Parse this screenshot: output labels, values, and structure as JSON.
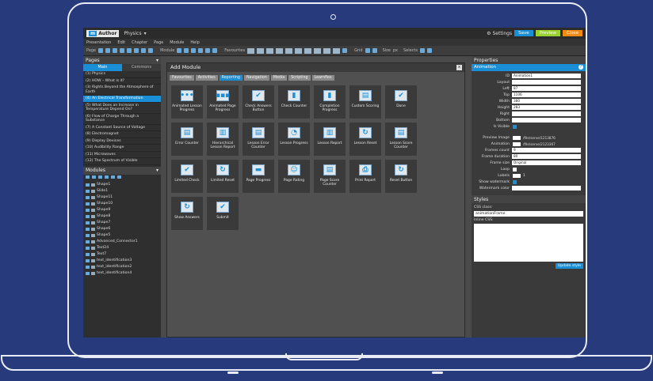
{
  "app": {
    "logo": "Author",
    "project": "Physics",
    "settings": "Settings",
    "save": "Save",
    "preview": "Preview",
    "close": "Close"
  },
  "menu": [
    "Presentation",
    "Edit",
    "Chapter",
    "Page",
    "Module",
    "Help"
  ],
  "toolbar": {
    "page": "Page",
    "module": "Module",
    "favourites": "Favourites",
    "grid": "Grid",
    "size": "Size",
    "px": "px",
    "selects": "Selects"
  },
  "pages_panel": {
    "title": "Pages",
    "tabs": [
      "Main",
      "Commons"
    ],
    "items": [
      "(1) Physics",
      "(2) HOW – What is it?",
      "(3) Rights Beyond the Atmosphere of Earth",
      "(4) An Electrical Transformation",
      "(5) What Does an Increase in Temperature Depend On?",
      "(6) Flow of Charge Through a Substance",
      "(7) A Constant Source of Voltage",
      "(8) Electromagnet",
      "(9) Display Devices",
      "(10) Audibility Range",
      "(11) Microwaves",
      "(12) The Spectrum of Visible"
    ],
    "selected_index": 3
  },
  "modules_panel": {
    "title": "Modules",
    "items": [
      "Shape1",
      "Slide1",
      "Shape11",
      "Shape10",
      "Shape9",
      "Shape8",
      "Shape7",
      "Shape6",
      "Shape5",
      "Advanced_Connector1",
      "Text24",
      "Text7",
      "text_identification3",
      "text_identification2",
      "text_identification4"
    ]
  },
  "dialog": {
    "title": "Add Module",
    "close": "x",
    "categories": [
      "Favourites",
      "Activities",
      "Reporting",
      "Navigation",
      "Media",
      "Scripting",
      "Learnflex"
    ],
    "active_category": "Reporting",
    "modules": [
      {
        "label": "Animated Lesson Progress",
        "icon": "progress-icon",
        "glyph": "•••"
      },
      {
        "label": "Animated Page Progress",
        "icon": "progress-icon",
        "glyph": "▪▪▪"
      },
      {
        "label": "Check Answers Button",
        "icon": "check-icon",
        "glyph": "✔"
      },
      {
        "label": "Check Counter",
        "icon": "counter-icon",
        "glyph": "▮"
      },
      {
        "label": "Completion Progress",
        "icon": "completion-icon",
        "glyph": "▮"
      },
      {
        "label": "Custom Scoring",
        "icon": "scoring-icon",
        "glyph": "▤"
      },
      {
        "label": "Done",
        "icon": "done-icon",
        "glyph": "✔"
      },
      {
        "label": "Error Counter",
        "icon": "error-counter-icon",
        "glyph": "▤"
      },
      {
        "label": "Hierarchical Lesson Report",
        "icon": "bar-chart-icon",
        "glyph": "▥"
      },
      {
        "label": "Lesson Error Counter",
        "icon": "error-counter-icon",
        "glyph": "▤"
      },
      {
        "label": "Lesson Progress",
        "icon": "pie-chart-icon",
        "glyph": "◔"
      },
      {
        "label": "Lesson Report",
        "icon": "bar-chart-icon",
        "glyph": "▥"
      },
      {
        "label": "Lesson Reset",
        "icon": "reset-icon",
        "glyph": "↻"
      },
      {
        "label": "Lesson Score Counter",
        "icon": "score-counter-icon",
        "glyph": "▤"
      },
      {
        "label": "Limited Check",
        "icon": "check-icon",
        "glyph": "✔"
      },
      {
        "label": "Limited Reset",
        "icon": "reset-icon",
        "glyph": "↻"
      },
      {
        "label": "Page Progress",
        "icon": "progress-bar-icon",
        "glyph": "▬"
      },
      {
        "label": "Page Rating",
        "icon": "rating-icon",
        "glyph": "☺"
      },
      {
        "label": "Page Score Counter",
        "icon": "score-counter-icon",
        "glyph": "▤"
      },
      {
        "label": "Print Report",
        "icon": "print-icon",
        "glyph": "⎙"
      },
      {
        "label": "Reset Button",
        "icon": "reset-icon",
        "glyph": "↻"
      },
      {
        "label": "Show Answers",
        "icon": "show-answers-icon",
        "glyph": "↻"
      },
      {
        "label": "Submit",
        "icon": "submit-icon",
        "glyph": "✔"
      }
    ]
  },
  "properties": {
    "title": "Properties",
    "section": "Animation",
    "fields": [
      {
        "label": "ID",
        "value": "Animation1"
      },
      {
        "label": "Layout",
        "value": ""
      },
      {
        "label": "Left",
        "value": "87"
      },
      {
        "label": "Top",
        "value": "1106"
      },
      {
        "label": "Width",
        "value": "380"
      },
      {
        "label": "Height",
        "value": "283"
      },
      {
        "label": "Right",
        "value": ""
      },
      {
        "label": "Bottom",
        "value": ""
      }
    ],
    "is_visible_label": "Is Visible",
    "preview_image_label": "Preview Image",
    "preview_image_value": "/file/serve/1213876",
    "animation_label": "Animation",
    "animation_value": "/file/serve/2123367",
    "frames_count_label": "Frames count",
    "frames_count_value": "9",
    "frame_duration_label": "Frame duration",
    "frame_duration_value": "80",
    "frame_size_label": "Frame size",
    "frame_size_value": "Original",
    "loop_label": "Loop",
    "labels_label": "Labels",
    "labels_value": "1",
    "show_watermark_label": "Show watermark",
    "watermark_color_label": "Watermark color"
  },
  "styles": {
    "title": "Styles",
    "css_class_label": "CSS class:",
    "css_class_value": "animationFrame",
    "inline_css_label": "Inline CSS:",
    "update_button": "Update style"
  },
  "colors": {
    "accent": "#1b8fd6",
    "save": "#1b8fd6",
    "preview": "#9bd231",
    "close": "#f28a18"
  }
}
